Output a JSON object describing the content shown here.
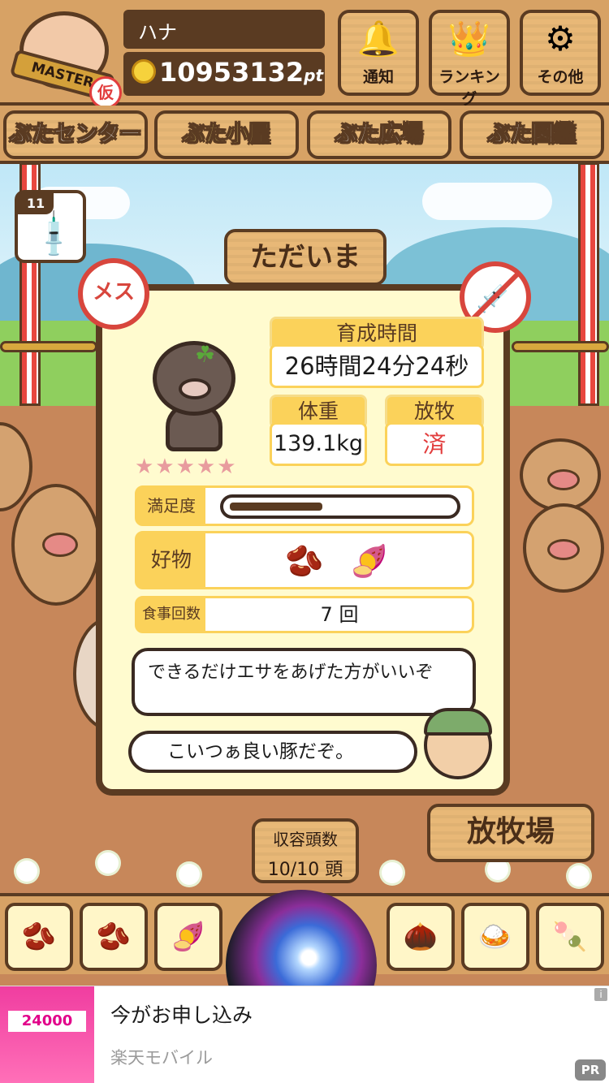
{
  "header": {
    "user_name": "ハナ",
    "points": "10953132",
    "points_unit": "pt",
    "rank_badge": "MASTER",
    "provisional_mark": "仮",
    "buttons": [
      {
        "label": "通知",
        "icon": "bell-icon"
      },
      {
        "label": "ランキング",
        "icon": "crown-icon"
      },
      {
        "label": "その他",
        "icon": "gear-icon"
      }
    ]
  },
  "nav": {
    "tabs": [
      "ぶたセンター",
      "ぶた小屋",
      "ぶた広場",
      "ぶた図鑑"
    ],
    "active": "ぶた小屋"
  },
  "syringe": {
    "count": "11"
  },
  "welcome_sign": "ただいま",
  "card": {
    "gender": "メス",
    "rating_stars": 5,
    "growth_time_label": "育成時間",
    "growth_time_value": "26時間24分24秒",
    "weight_label": "体重",
    "weight_value": "139.1kg",
    "grazing_label": "放牧",
    "grazing_value": "済",
    "satisfaction_label": "満足度",
    "satisfaction_level": 0.42,
    "favorites_label": "好物",
    "favorites": [
      "beans-icon",
      "sweet-potato-icon"
    ],
    "meals_label": "食事回数",
    "meals_value": "7 回",
    "advice_text": "できるだけエサをあげた方がいいぞ",
    "comment_text": "こいつぁ良い豚だぞ。"
  },
  "capacity": {
    "label": "収容頭数",
    "value": "10/10 頭"
  },
  "pasture_sign": "放牧場",
  "food_bar": [
    "beans-icon",
    "beans-icon",
    "sweet-potato-icon",
    "",
    "",
    "acorn-icon",
    "beans-plate-icon",
    "meatballs-icon"
  ],
  "ad": {
    "title": "今がお申し込み",
    "brand": "楽天モバイル",
    "thumb_price": "24000",
    "pr_label": "PR",
    "info_label": "i"
  },
  "colors": {
    "wood": "#e8b877",
    "outline": "#5a3b22",
    "card_bg": "#fffbcf",
    "label_yellow": "#fbd25a",
    "accent_red": "#e23d3d"
  }
}
